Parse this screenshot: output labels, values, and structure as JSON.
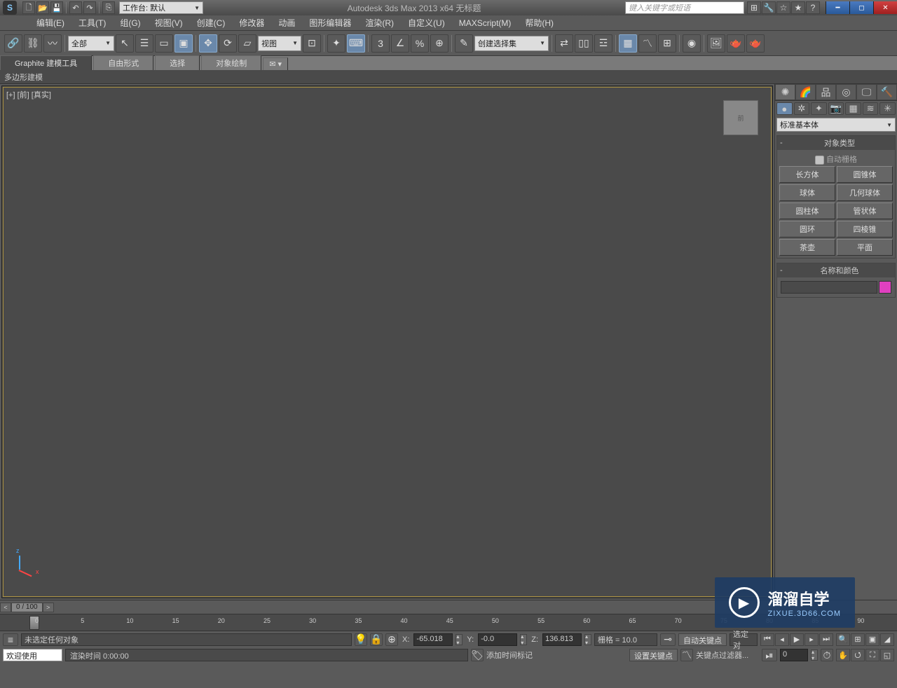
{
  "app": {
    "logo": "S",
    "title": "Autodesk 3ds Max  2013 x64     无标题"
  },
  "qat": {
    "workspace": "工作台: 默认"
  },
  "search": {
    "placeholder": "键入关键字或短语"
  },
  "menus": [
    "编辑(E)",
    "工具(T)",
    "组(G)",
    "视图(V)",
    "创建(C)",
    "修改器",
    "动画",
    "图形编辑器",
    "渲染(R)",
    "自定义(U)",
    "MAXScript(M)",
    "帮助(H)"
  ],
  "toolbar": {
    "filter_all": "全部",
    "view": "视图",
    "selection_set": "创建选择集"
  },
  "ribbon": {
    "tabs": [
      "Graphite 建模工具",
      "自由形式",
      "选择",
      "对象绘制"
    ],
    "sub": "多边形建模"
  },
  "viewport": {
    "label": "[+] [前] [真实]",
    "cube": "前"
  },
  "cmdpanel": {
    "dropdown": "标准基本体",
    "rollout1_title": "对象类型",
    "auto_grid": "自动栅格",
    "primitives": [
      [
        "长方体",
        "圆锥体"
      ],
      [
        "球体",
        "几何球体"
      ],
      [
        "圆柱体",
        "管状体"
      ],
      [
        "圆环",
        "四棱锥"
      ],
      [
        "茶壶",
        "平面"
      ]
    ],
    "rollout2_title": "名称和颜色"
  },
  "timeline": {
    "frames": "0 / 100",
    "ticks": [
      "0",
      "5",
      "10",
      "15",
      "20",
      "25",
      "30",
      "35",
      "40",
      "45",
      "50",
      "55",
      "60",
      "65",
      "70",
      "75",
      "80",
      "85",
      "90"
    ]
  },
  "status": {
    "no_sel": "未选定任何对象",
    "x_label": "X:",
    "x": "-65.018",
    "y_label": "Y:",
    "y": "-0.0",
    "z_label": "Z:",
    "z": "136.813",
    "grid": "栅格 = 10.0",
    "auto_key": "自动关键点",
    "sel_lock": "选定对",
    "set_key": "设置关键点",
    "key_filter": "关键点过滤器...",
    "frame_cur": "0"
  },
  "status2": {
    "welcome": "欢迎使用  MAXScr",
    "render_label": "渲染时间  0:00:00",
    "add_time_tag": "添加时间标记"
  },
  "watermark": {
    "big": "溜溜自学",
    "small": "ZIXUE.3D66.COM"
  }
}
